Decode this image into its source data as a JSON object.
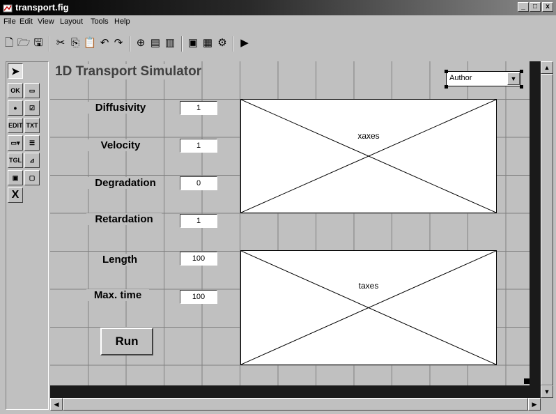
{
  "window": {
    "title": "transport.fig",
    "minimize": "_",
    "maximize": "□",
    "close": "x"
  },
  "menu": [
    "File",
    "Edit",
    "View",
    "Layout",
    "Tools",
    "Help"
  ],
  "toolbar_icons": [
    "new-file-icon",
    "open-folder-icon",
    "save-icon",
    "cut-icon",
    "copy-icon",
    "paste-icon",
    "undo-icon",
    "redo-icon",
    "align-icon",
    "menu-editor-icon",
    "tab-order-icon",
    "m-file-editor-icon",
    "property-inspector-icon",
    "object-browser-icon",
    "run-icon"
  ],
  "palette": [
    {
      "name": "select-arrow-icon",
      "glyph": "➤"
    },
    {
      "name": "push-button-tool",
      "glyph": "OK"
    },
    {
      "name": "slider-tool",
      "glyph": "▭"
    },
    {
      "name": "radio-button-tool",
      "glyph": "●"
    },
    {
      "name": "checkbox-tool",
      "glyph": "☑"
    },
    {
      "name": "edit-text-tool",
      "glyph": "EDIT"
    },
    {
      "name": "static-text-tool",
      "glyph": "TXT"
    },
    {
      "name": "popup-menu-tool",
      "glyph": "▭▾"
    },
    {
      "name": "listbox-tool",
      "glyph": "☰"
    },
    {
      "name": "toggle-button-tool",
      "glyph": "TGL"
    },
    {
      "name": "axes-tool",
      "glyph": "⊿"
    },
    {
      "name": "frame-tool",
      "glyph": "▣"
    },
    {
      "name": "panel-tool",
      "glyph": "▢"
    },
    {
      "name": "activex-tool",
      "glyph": "X"
    }
  ],
  "canvas": {
    "title": "1D Transport Simulator",
    "params": [
      {
        "label": "Diffusivity",
        "value": "1"
      },
      {
        "label": "Velocity",
        "value": "1"
      },
      {
        "label": "Degradation",
        "value": "0"
      },
      {
        "label": "Retardation",
        "value": "1"
      },
      {
        "label": "Length",
        "value": "100"
      },
      {
        "label": "Max. time",
        "value": "100"
      }
    ],
    "run_label": "Run",
    "axes": [
      "xaxes",
      "taxes"
    ],
    "popup_value": "Author"
  },
  "colors": {
    "background": "#c0c0c0",
    "title_bar": "#000000",
    "grid_line": "#808080",
    "axes_fill": "#ffffff"
  }
}
